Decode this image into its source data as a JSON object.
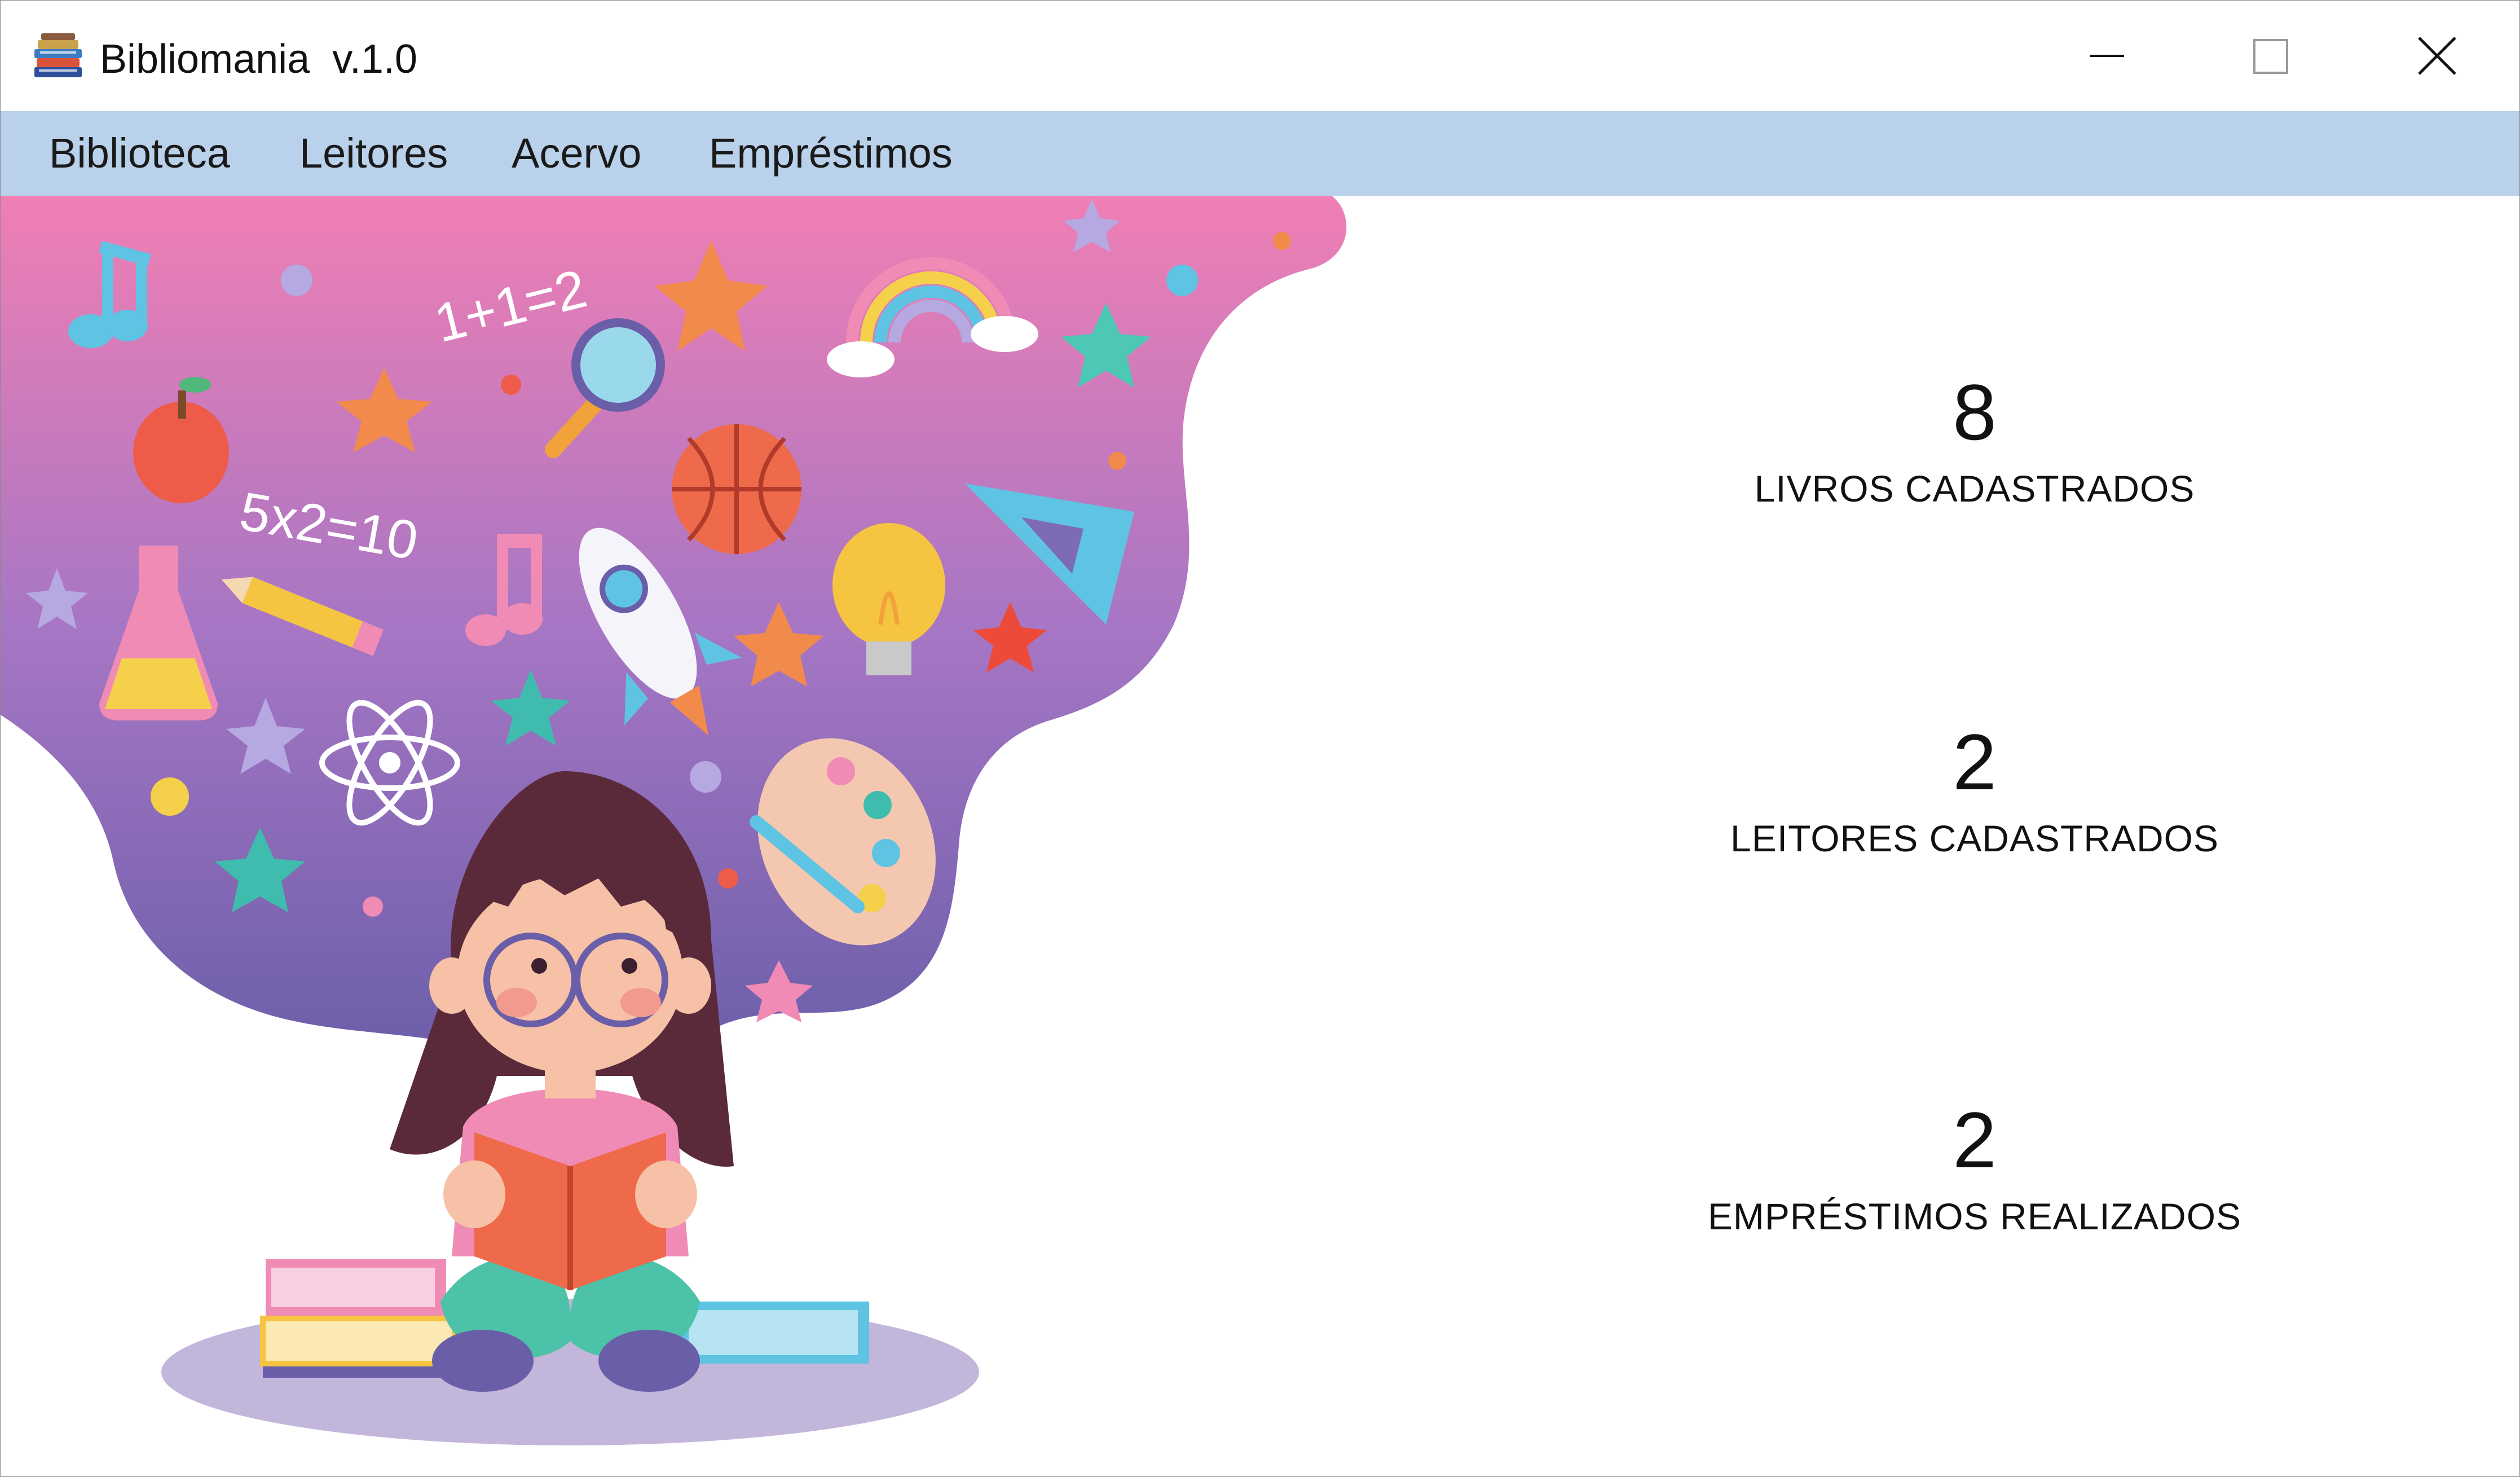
{
  "window": {
    "title": "Bibliomania  v.1.0",
    "icon": "books-stack-icon",
    "controls": [
      "minimize-icon",
      "maximize-icon",
      "close-icon"
    ]
  },
  "menu": {
    "items": [
      {
        "label": "Biblioteca"
      },
      {
        "label": "Leitores"
      },
      {
        "label": "Acervo"
      },
      {
        "label": "Empréstimos"
      }
    ]
  },
  "illustration": {
    "texts": {
      "eq1": "1+1=2",
      "eq2": "5x2=10"
    }
  },
  "stats": [
    {
      "value": "8",
      "label": "LIVROS CADASTRADOS"
    },
    {
      "value": "2",
      "label": "LEITORES CADASTRADOS"
    },
    {
      "value": "2",
      "label": "EMPRÉSTIMOS REALIZADOS"
    }
  ],
  "colors": {
    "menubar": "#b9d1ea",
    "gradient_top": "#f07fb4",
    "gradient_bottom": "#6a5ea9",
    "shadow": "#c3b6db"
  }
}
